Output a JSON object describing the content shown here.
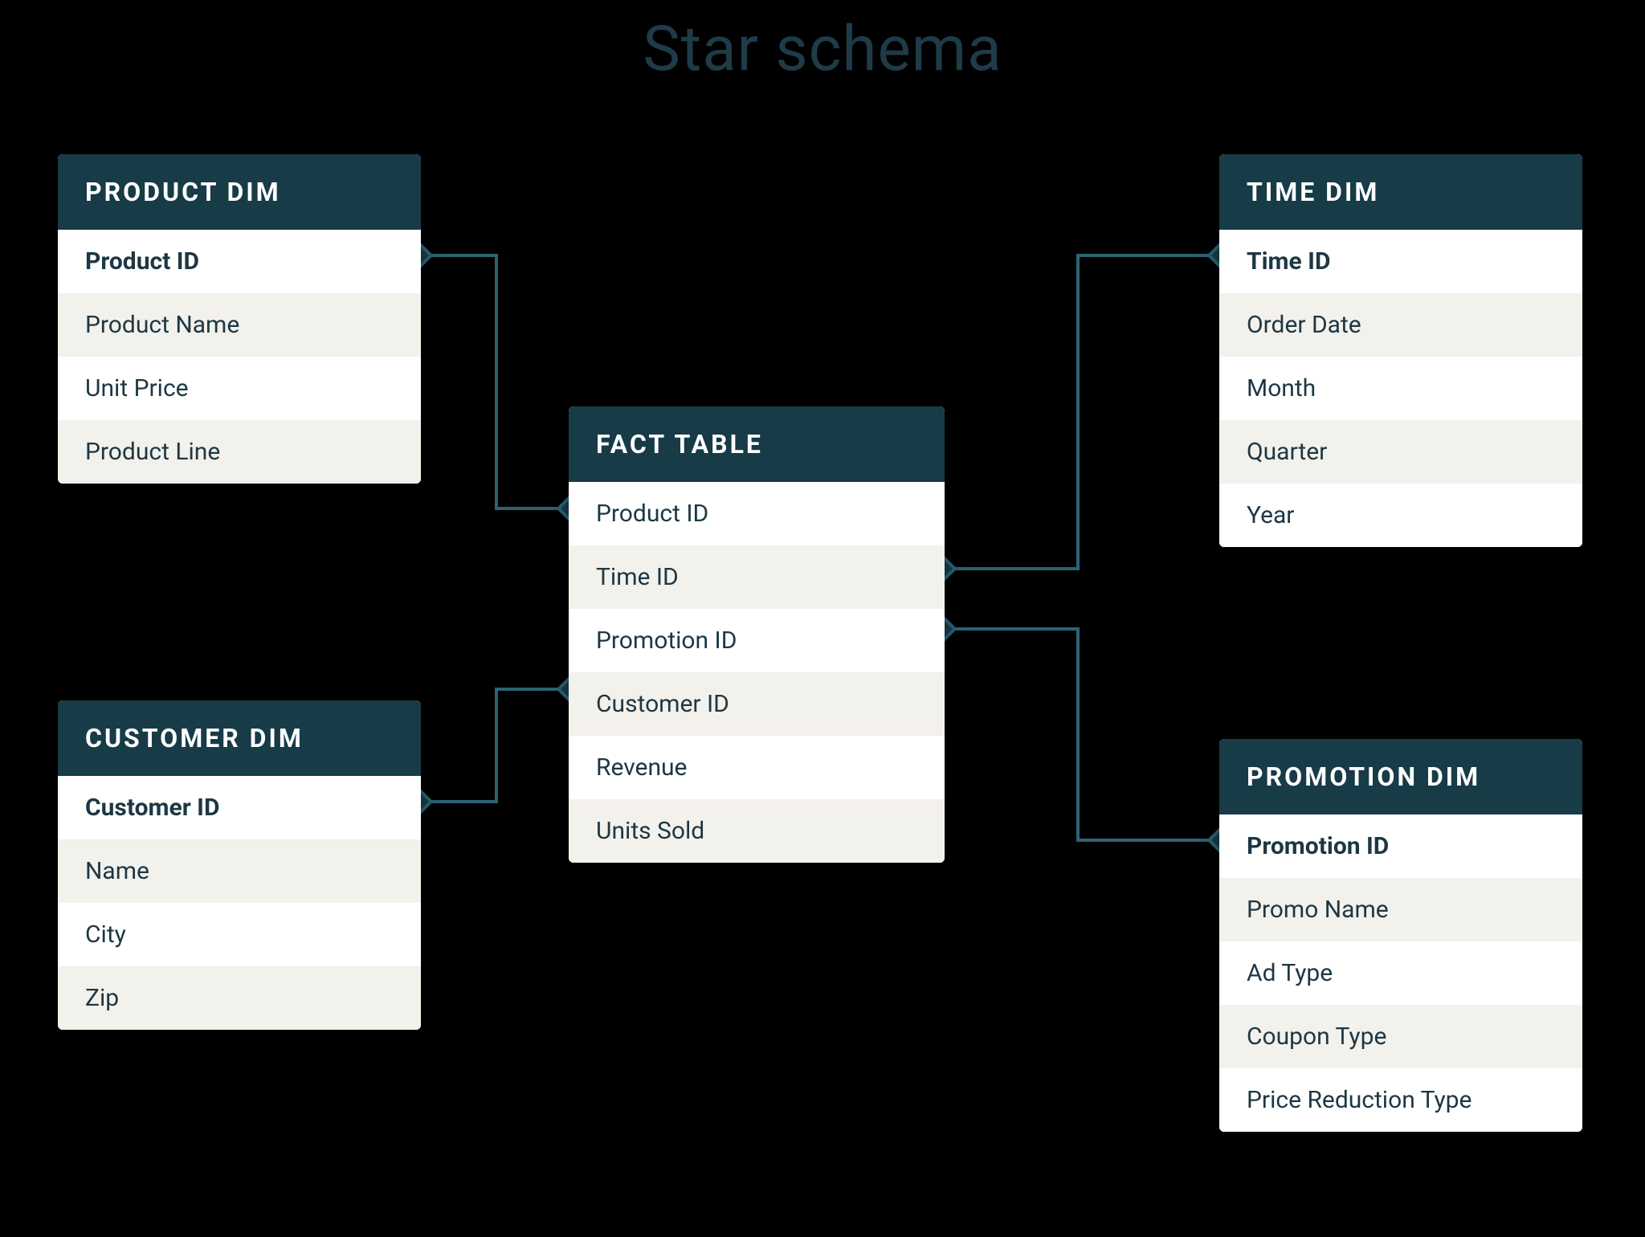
{
  "title": "Star schema",
  "colors": {
    "header_bg": "#173b47",
    "connector_stroke": "#2b6374",
    "row_text": "#1d3744",
    "row_alt_bg": "#f3f1eb",
    "row_bg": "#ffffff",
    "page_bg": "#000000"
  },
  "tables": {
    "product": {
      "title": "PRODUCT DIM",
      "key": "Product ID",
      "fields": [
        "Product Name",
        "Unit Price",
        "Product Line"
      ]
    },
    "time": {
      "title": "TIME DIM",
      "key": "Time ID",
      "fields": [
        "Order Date",
        "Month",
        "Quarter",
        "Year"
      ]
    },
    "fact": {
      "title": "FACT TABLE",
      "key": null,
      "fields": [
        "Product ID",
        "Time ID",
        "Promotion ID",
        "Customer ID",
        "Revenue",
        "Units Sold"
      ]
    },
    "customer": {
      "title": "CUSTOMER DIM",
      "key": "Customer ID",
      "fields": [
        "Name",
        "City",
        "Zip"
      ]
    },
    "promotion": {
      "title": "PROMOTION DIM",
      "key": "Promotion ID",
      "fields": [
        "Promo Name",
        "Ad Type",
        "Coupon Type",
        "Price Reduction Type"
      ]
    }
  },
  "relationships": [
    {
      "from": "product.Product ID",
      "to": "fact.Product ID"
    },
    {
      "from": "time.Time ID",
      "to": "fact.Time ID"
    },
    {
      "from": "customer.Customer ID",
      "to": "fact.Customer ID"
    },
    {
      "from": "promotion.Promotion ID",
      "to": "fact.Promotion ID"
    }
  ]
}
